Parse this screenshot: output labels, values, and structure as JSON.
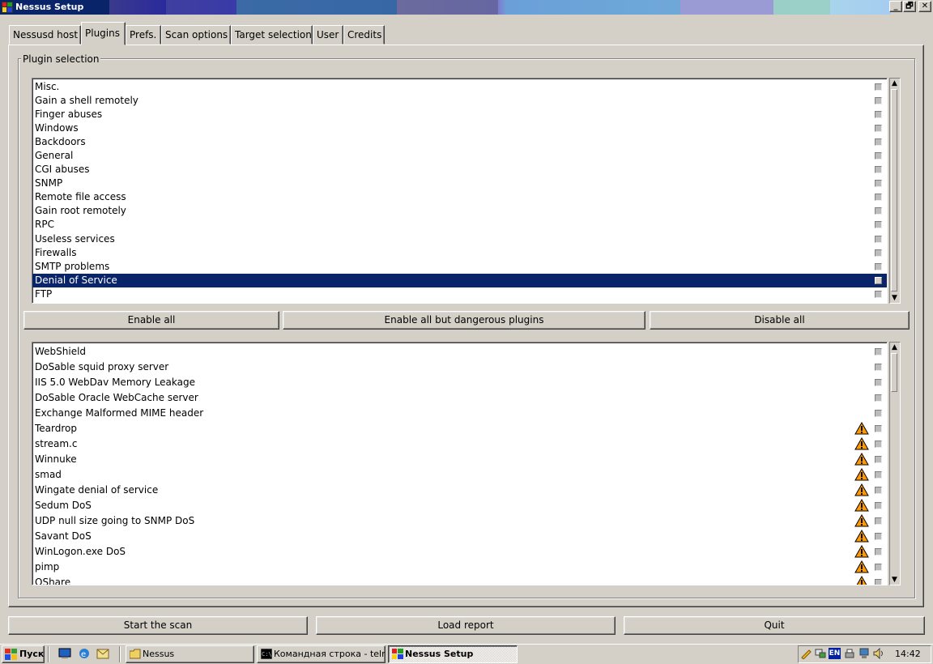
{
  "window": {
    "title": "Nessus Setup",
    "controls": [
      "_",
      "🗗",
      "✕"
    ]
  },
  "tabs": [
    {
      "label": "Nessusd host",
      "active": false
    },
    {
      "label": "Plugins",
      "active": true
    },
    {
      "label": "Prefs.",
      "active": false
    },
    {
      "label": "Scan options",
      "active": false
    },
    {
      "label": "Target selection",
      "active": false
    },
    {
      "label": "User",
      "active": false
    },
    {
      "label": "Credits",
      "active": false
    }
  ],
  "plugin_selection": {
    "group_label": "Plugin selection",
    "families": [
      {
        "label": "Misc.",
        "checked": false,
        "selected": false
      },
      {
        "label": "Gain a shell remotely",
        "checked": false,
        "selected": false
      },
      {
        "label": "Finger abuses",
        "checked": false,
        "selected": false
      },
      {
        "label": "Windows",
        "checked": false,
        "selected": false
      },
      {
        "label": "Backdoors",
        "checked": false,
        "selected": false
      },
      {
        "label": "General",
        "checked": false,
        "selected": false
      },
      {
        "label": "CGI abuses",
        "checked": false,
        "selected": false
      },
      {
        "label": "SNMP",
        "checked": false,
        "selected": false
      },
      {
        "label": "Remote file access",
        "checked": false,
        "selected": false
      },
      {
        "label": "Gain root remotely",
        "checked": false,
        "selected": false
      },
      {
        "label": "RPC",
        "checked": false,
        "selected": false
      },
      {
        "label": "Useless services",
        "checked": false,
        "selected": false
      },
      {
        "label": "Firewalls",
        "checked": false,
        "selected": false
      },
      {
        "label": "SMTP problems",
        "checked": false,
        "selected": false
      },
      {
        "label": "Denial of Service",
        "checked": false,
        "selected": true
      },
      {
        "label": "FTP",
        "checked": false,
        "selected": false
      }
    ],
    "buttons": {
      "enable_all": "Enable all",
      "enable_safe": "Enable all but dangerous plugins",
      "disable_all": "Disable all"
    },
    "plugins": [
      {
        "label": "WebShield",
        "dangerous": false,
        "checked": false
      },
      {
        "label": "DoSable squid proxy server",
        "dangerous": false,
        "checked": false
      },
      {
        "label": "IIS 5.0 WebDav Memory Leakage",
        "dangerous": false,
        "checked": false
      },
      {
        "label": "DoSable Oracle WebCache server",
        "dangerous": false,
        "checked": false
      },
      {
        "label": "Exchange Malformed MIME header",
        "dangerous": false,
        "checked": false
      },
      {
        "label": "Teardrop",
        "dangerous": true,
        "checked": false
      },
      {
        "label": "stream.c",
        "dangerous": true,
        "checked": false
      },
      {
        "label": "Winnuke",
        "dangerous": true,
        "checked": false
      },
      {
        "label": "smad",
        "dangerous": true,
        "checked": false
      },
      {
        "label": "Wingate denial of service",
        "dangerous": true,
        "checked": false
      },
      {
        "label": "Sedum DoS",
        "dangerous": true,
        "checked": false
      },
      {
        "label": "UDP null size going to SNMP DoS",
        "dangerous": true,
        "checked": false
      },
      {
        "label": "Savant DoS",
        "dangerous": true,
        "checked": false
      },
      {
        "label": "WinLogon.exe DoS",
        "dangerous": true,
        "checked": false
      },
      {
        "label": "pimp",
        "dangerous": true,
        "checked": false
      },
      {
        "label": "OShare",
        "dangerous": true,
        "checked": false
      }
    ]
  },
  "actions": {
    "start_scan": "Start the scan",
    "load_report": "Load report",
    "quit": "Quit"
  },
  "taskbar": {
    "start_label": "Пуск",
    "tasks": [
      {
        "label": "Nessus",
        "active": false
      },
      {
        "label": "Командная строка - teln...",
        "active": false
      },
      {
        "label": "Nessus Setup",
        "active": true
      }
    ],
    "tray_lang": "EN",
    "clock": "14:42"
  },
  "colors": {
    "selection": "#0a246a",
    "warning": "#ff9900",
    "face": "#d4d0c8"
  }
}
